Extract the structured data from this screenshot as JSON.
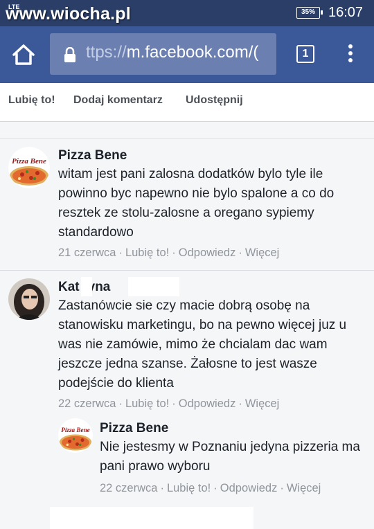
{
  "status_bar": {
    "network": "LTE",
    "watermark": "www.wiocha.pl",
    "battery": "35%",
    "time": "16:07"
  },
  "browser": {
    "url_dim": "ttps://",
    "url_main": "m.facebook.com/(",
    "tab_count": "1"
  },
  "actions": {
    "like": "Lubię to!",
    "comment": "Dodaj komentarz",
    "share": "Udostępnij"
  },
  "comments": [
    {
      "author": "Pizza Bene",
      "avatar_label": "Pizza Bene",
      "text": "witam jest pani zalosna dodatków bylo tyle ile powinno byc napewno nie bylo spalone a co do resztek ze stolu-zalosne a oregano sypiemy standardowo",
      "date": "21 czerwca",
      "like": "Lubię to!",
      "reply": "Odpowiedz",
      "more": "Więcej"
    },
    {
      "author_part1": "Kat",
      "author_part2": "yna",
      "text": "Zastanówcie sie czy macie dobrą osobę na stanowisku marketingu, bo na pewno więcej juz u was nie zamówie, mimo że chcialam dac wam jeszcze jedna szanse. Żałosne to jest wasze podejście do klienta",
      "date": "22 czerwca",
      "like": "Lubię to!",
      "reply": "Odpowiedz",
      "more": "Więcej"
    },
    {
      "author": "Pizza Bene",
      "avatar_label": "Pizza Bene",
      "text": "Nie jestesmy w Poznaniu jedyna pizzeria ma pani prawo wyboru",
      "date": "22 czerwca",
      "like": "Lubię to!",
      "reply": "Odpowiedz",
      "more": "Więcej"
    }
  ],
  "colors": {
    "facebook_blue": "#3b5998",
    "status_bar": "#2a3e68",
    "meta_grey": "#90949c"
  }
}
